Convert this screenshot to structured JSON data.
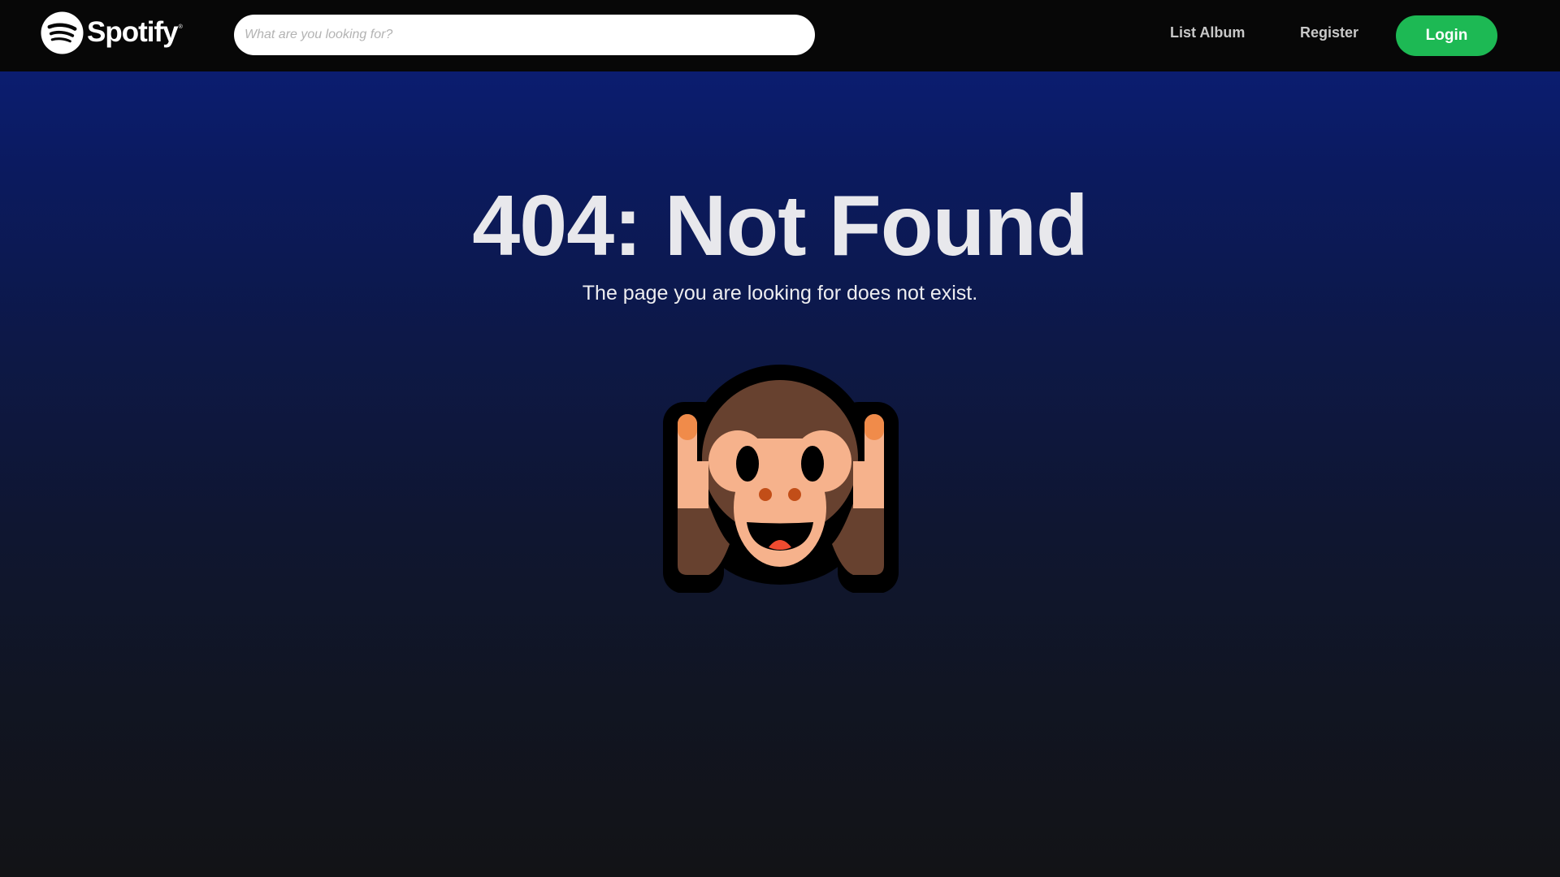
{
  "header": {
    "logo_text": "Spotify",
    "logo_registered": "®",
    "search_placeholder": "What are you looking for?",
    "nav": {
      "list_album": "List Album",
      "register": "Register",
      "login": "Login"
    }
  },
  "main": {
    "title": "404: Not Found",
    "subtitle": "The page you are looking for does not exist.",
    "illustration_icon": "hear-no-evil-monkey-icon"
  },
  "colors": {
    "accent": "#1db954",
    "topbar": "#070707",
    "gradient_top": "#0b1f7c",
    "gradient_bottom": "#121316"
  }
}
